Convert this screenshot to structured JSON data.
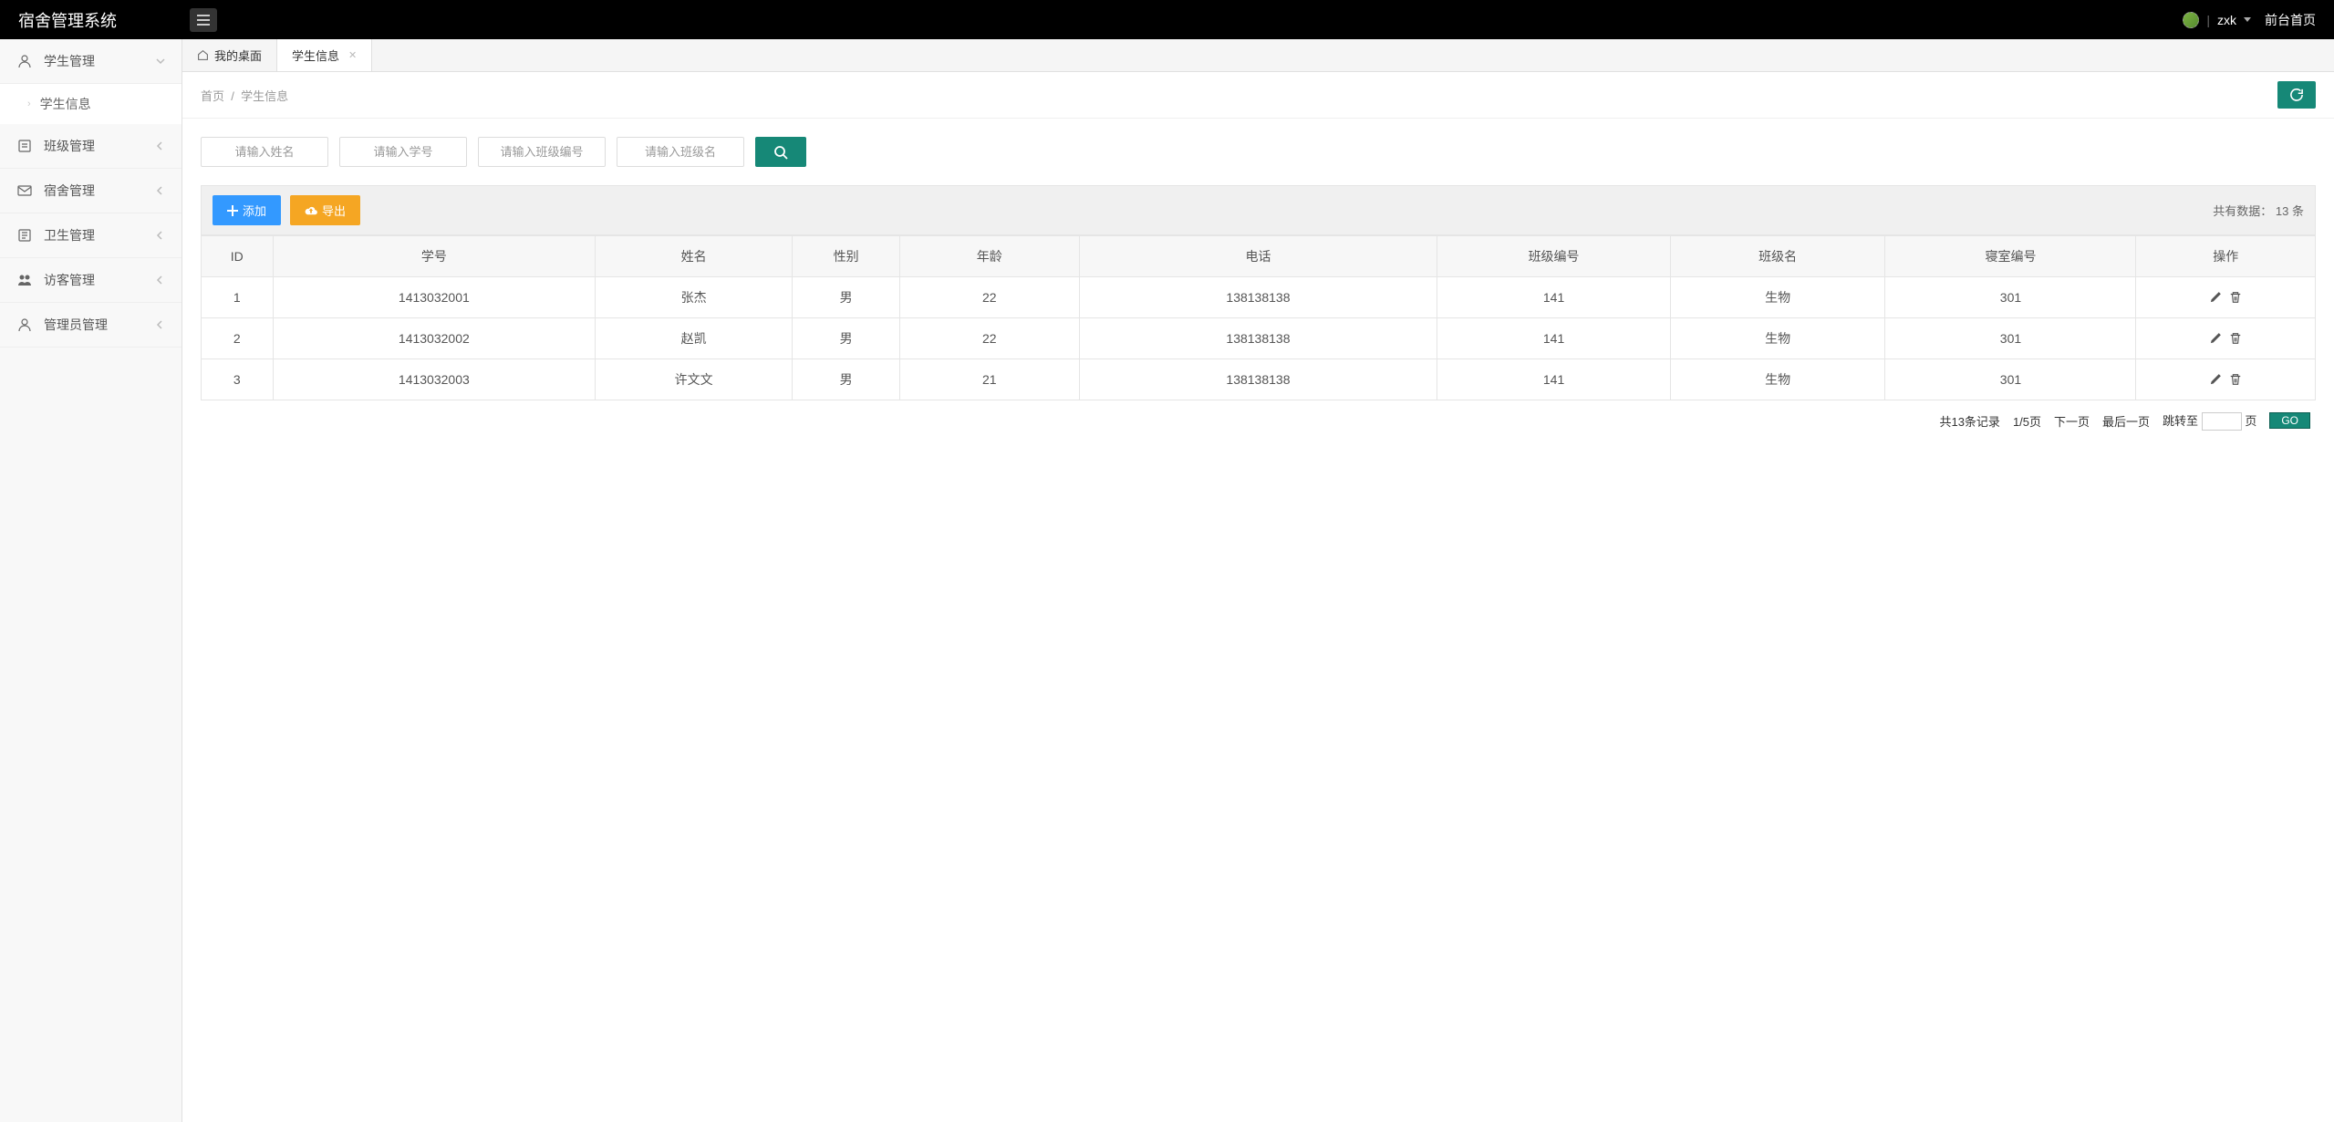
{
  "header": {
    "title": "宿舍管理系统",
    "username": "zxk",
    "frontLink": "前台首页"
  },
  "sidebar": {
    "items": [
      {
        "label": "学生管理",
        "expanded": true,
        "children": [
          {
            "label": "学生信息"
          }
        ]
      },
      {
        "label": "班级管理",
        "expanded": false
      },
      {
        "label": "宿舍管理",
        "expanded": false
      },
      {
        "label": "卫生管理",
        "expanded": false
      },
      {
        "label": "访客管理",
        "expanded": false
      },
      {
        "label": "管理员管理",
        "expanded": false
      }
    ]
  },
  "tabs": {
    "desktop": "我的桌面",
    "active": "学生信息"
  },
  "breadcrumb": {
    "home": "首页",
    "current": "学生信息"
  },
  "search": {
    "placeholders": {
      "name": "请输入姓名",
      "sno": "请输入学号",
      "classNo": "请输入班级编号",
      "className": "请输入班级名"
    }
  },
  "buttons": {
    "add": "添加",
    "export": "导出",
    "go": "GO"
  },
  "dataCount": {
    "prefix": "共有数据：",
    "num": "13",
    "suffix": " 条"
  },
  "table": {
    "headers": [
      "ID",
      "学号",
      "姓名",
      "性别",
      "年龄",
      "电话",
      "班级编号",
      "班级名",
      "寝室编号",
      "操作"
    ],
    "rows": [
      {
        "id": "1",
        "sno": "1413032001",
        "name": "张杰",
        "sex": "男",
        "age": "22",
        "phone": "138138138",
        "classNo": "141",
        "className": "生物",
        "dorm": "301"
      },
      {
        "id": "2",
        "sno": "1413032002",
        "name": "赵凯",
        "sex": "男",
        "age": "22",
        "phone": "138138138",
        "classNo": "141",
        "className": "生物",
        "dorm": "301"
      },
      {
        "id": "3",
        "sno": "1413032003",
        "name": "许文文",
        "sex": "男",
        "age": "21",
        "phone": "138138138",
        "classNo": "141",
        "className": "生物",
        "dorm": "301"
      }
    ]
  },
  "pagination": {
    "total": "共13条记录",
    "page": "1/5页",
    "next": "下一页",
    "last": "最后一页",
    "jump": "跳转至",
    "pageSuffix": "页"
  }
}
